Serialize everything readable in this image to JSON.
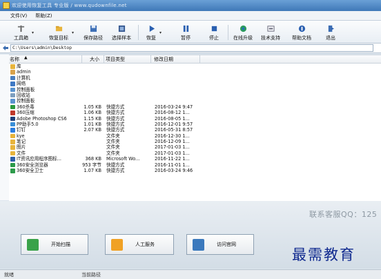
{
  "window": {
    "title": "欢迎使用恢复工具 专业版 / www.qudownfile.net"
  },
  "menu": {
    "file": "文件(V)",
    "help": "帮助(Z)"
  },
  "toolbar": {
    "tools": "工具箱",
    "restore_target": "恢复目标",
    "save_path": "保存路径",
    "select_sample": "选择样本",
    "restore": "恢复",
    "pause": "暂停",
    "stop": "停止",
    "online_upgrade": "在线升级",
    "tech_support": "技术支持",
    "help_doc": "帮助文档",
    "exit": "退出"
  },
  "address": {
    "path": "C:\\Users\\admin\\Desktop"
  },
  "list": {
    "columns": {
      "name": "名称",
      "size": "大小",
      "type": "项目类型",
      "date": "修改日期"
    },
    "rows": [
      {
        "name": "库",
        "size": "",
        "type": "",
        "date": "",
        "color": "#e8b43c"
      },
      {
        "name": "admin",
        "size": "",
        "type": "",
        "date": "",
        "color": "#d9a24a"
      },
      {
        "name": "计算机",
        "size": "",
        "type": "",
        "date": "",
        "color": "#4a7fc0"
      },
      {
        "name": "网络",
        "size": "",
        "type": "",
        "date": "",
        "color": "#3f79c4"
      },
      {
        "name": "控制面板",
        "size": "",
        "type": "",
        "date": "",
        "color": "#5a93cf"
      },
      {
        "name": "回收站",
        "size": "",
        "type": "",
        "date": "",
        "color": "#7e9fbf"
      },
      {
        "name": "控制面板",
        "size": "",
        "type": "",
        "date": "",
        "color": "#5a93cf"
      },
      {
        "name": "360杀毒",
        "size": "1.05 KB",
        "type": "快捷方式",
        "date": "2016-03-24 9:47",
        "color": "#2c9a3e"
      },
      {
        "name": "360压缩",
        "size": "1.06 KB",
        "type": "快捷方式",
        "date": "2016-08-12 1...",
        "color": "#c0392b"
      },
      {
        "name": "Adobe Photoshop CS6",
        "size": "1.15 KB",
        "type": "快捷方式",
        "date": "2016-08-05 1...",
        "color": "#1e3f7a"
      },
      {
        "name": "PP助手5.0",
        "size": "1.01 KB",
        "type": "快捷方式",
        "date": "2016-12-01 9:57",
        "color": "#3a8fd8"
      },
      {
        "name": "钉钉",
        "size": "2.07 KB",
        "type": "快捷方式",
        "date": "2016-05-31 8:57",
        "color": "#2b7de0"
      },
      {
        "name": "kye",
        "size": "",
        "type": "文件夹",
        "date": "2016-12-30 1...",
        "color": "#e8b43c"
      },
      {
        "name": "笔记",
        "size": "",
        "type": "文件夹",
        "date": "2016-12-09 1...",
        "color": "#e8b43c"
      },
      {
        "name": "图片",
        "size": "",
        "type": "文件夹",
        "date": "2017-01-03 1...",
        "color": "#e8b43c"
      },
      {
        "name": "文件",
        "size": "",
        "type": "文件夹",
        "date": "2017-01-03 1...",
        "color": "#e8b43c"
      },
      {
        "name": "IT资讯应用程序图标...",
        "size": "368 KB",
        "type": "Microsoft Wo...",
        "date": "2016-11-22 1...",
        "color": "#2f5fa8"
      },
      {
        "name": "360安全浏览器",
        "size": "953 字节",
        "type": "快捷方式",
        "date": "2016-11-01 1...",
        "color": "#2d9b4a"
      },
      {
        "name": "360安全卫士",
        "size": "1.07 KB",
        "type": "快捷方式",
        "date": "2016-03-24 9:46",
        "color": "#2d9b4a"
      }
    ]
  },
  "actions": {
    "scan": "开始扫描",
    "manual": "人工服务",
    "website": "访问官网"
  },
  "contact": {
    "qq": "联系客服QQ：125"
  },
  "watermark": "最需教育",
  "status": {
    "left": "就绪",
    "middle": "当前路径"
  }
}
